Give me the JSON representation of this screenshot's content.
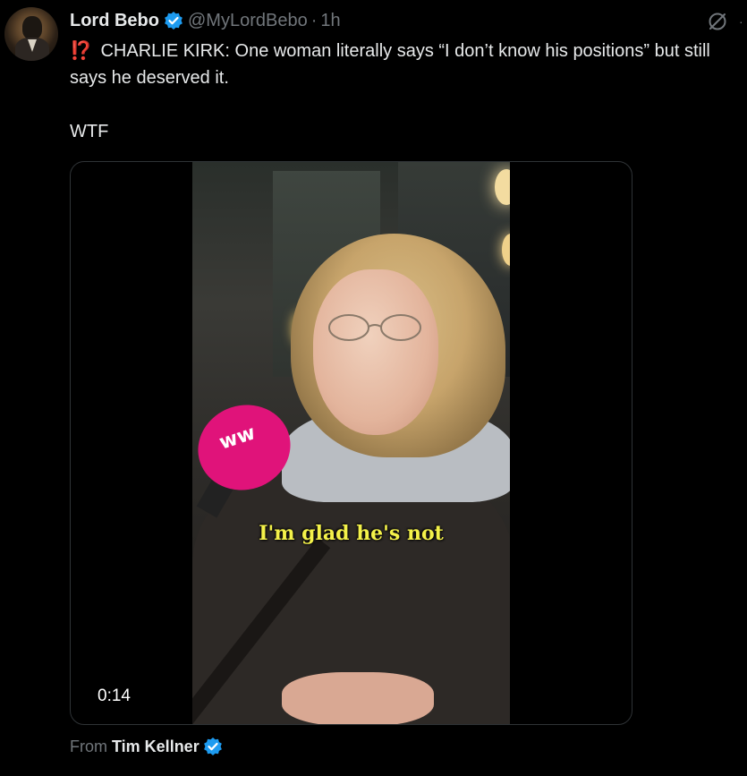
{
  "post": {
    "author_name": "Lord Bebo",
    "author_handle": "@MyLordBebo",
    "separator": "·",
    "time": "1h",
    "text_emoji": "⁉️",
    "text_body": "CHARLIE KIRK: One woman literally says “I don’t know his positions” but still says he deserved it.",
    "text_extra": "WTF"
  },
  "media": {
    "caption": "I'm glad he's not",
    "duration": "0:14",
    "mic_logo": "ww"
  },
  "source": {
    "label": "From",
    "name": "Tim Kellner"
  },
  "icons": {
    "verified": "verified-badge-icon",
    "grok": "grok-icon",
    "more": "more-icon"
  },
  "colors": {
    "background": "#000000",
    "text": "#e7e9ea",
    "muted": "#71767b",
    "verified": "#1d9bf0",
    "caption": "#f4f24a",
    "mic": "#e0137a"
  }
}
